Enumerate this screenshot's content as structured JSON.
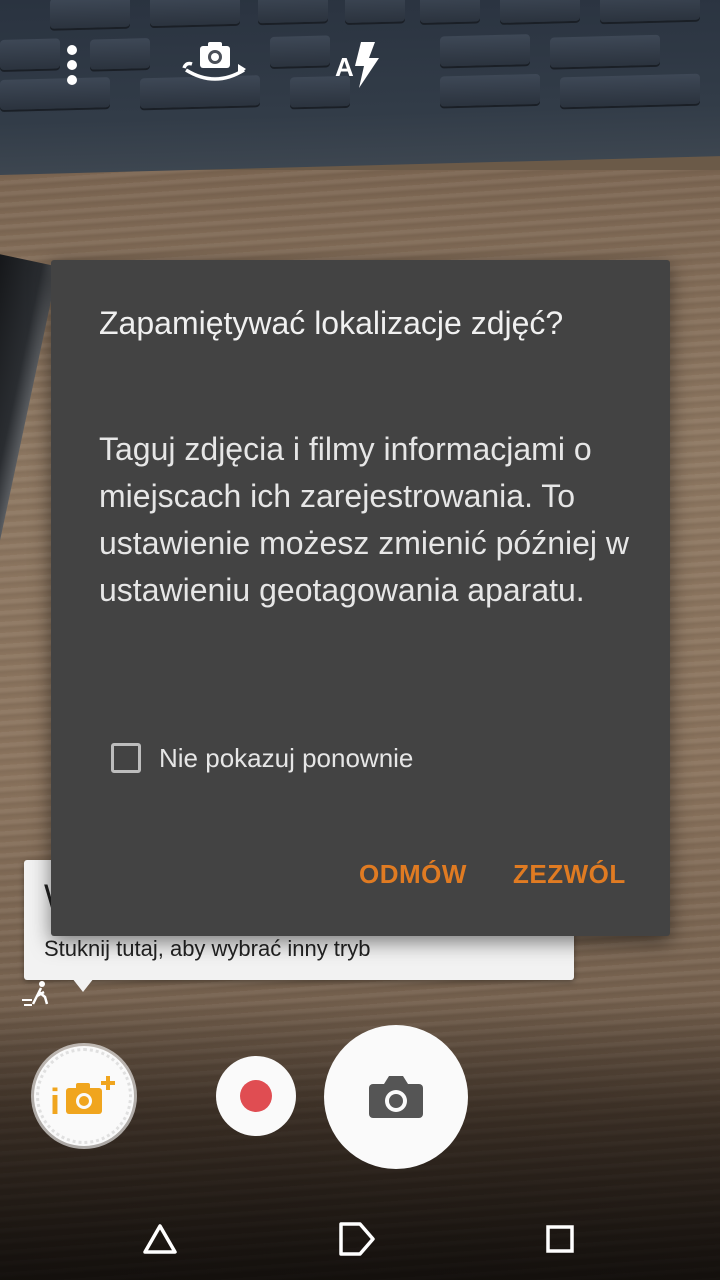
{
  "top_bar": {
    "menu_icon": "vertical-dots-icon",
    "switch_camera_icon": "camera-switch-icon",
    "flash_icon": "flash-auto-icon",
    "flash_icon_letter": "A"
  },
  "mode_hint": {
    "title_partial": "W",
    "text": "Stuknij tutaj, aby wybrać inny tryb"
  },
  "dialog": {
    "title": "Zapamiętywać lokalizacje zdjęć?",
    "message": "Taguj zdjęcia i filmy informacjami o miejscach ich zarejestrowania. To ustawienie możesz zmienić później w ustawieniu geotagowania aparatu.",
    "checkbox_label": "Nie pokazuj ponownie",
    "checkbox_checked": false,
    "deny_label": "ODMÓW",
    "allow_label": "ZEZWÓL",
    "accent_color": "#e07b22"
  },
  "controls": {
    "mode_button_icon": "intelligent-auto-plus-icon",
    "mode_button_text": "i",
    "record_icon": "record-dot-icon",
    "shutter_icon": "camera-icon",
    "record_color": "#e04d52",
    "mode_color": "#f0a51e"
  },
  "nav": {
    "back_icon": "triangle-back-icon",
    "home_icon": "home-icon",
    "recents_icon": "square-recents-icon"
  }
}
